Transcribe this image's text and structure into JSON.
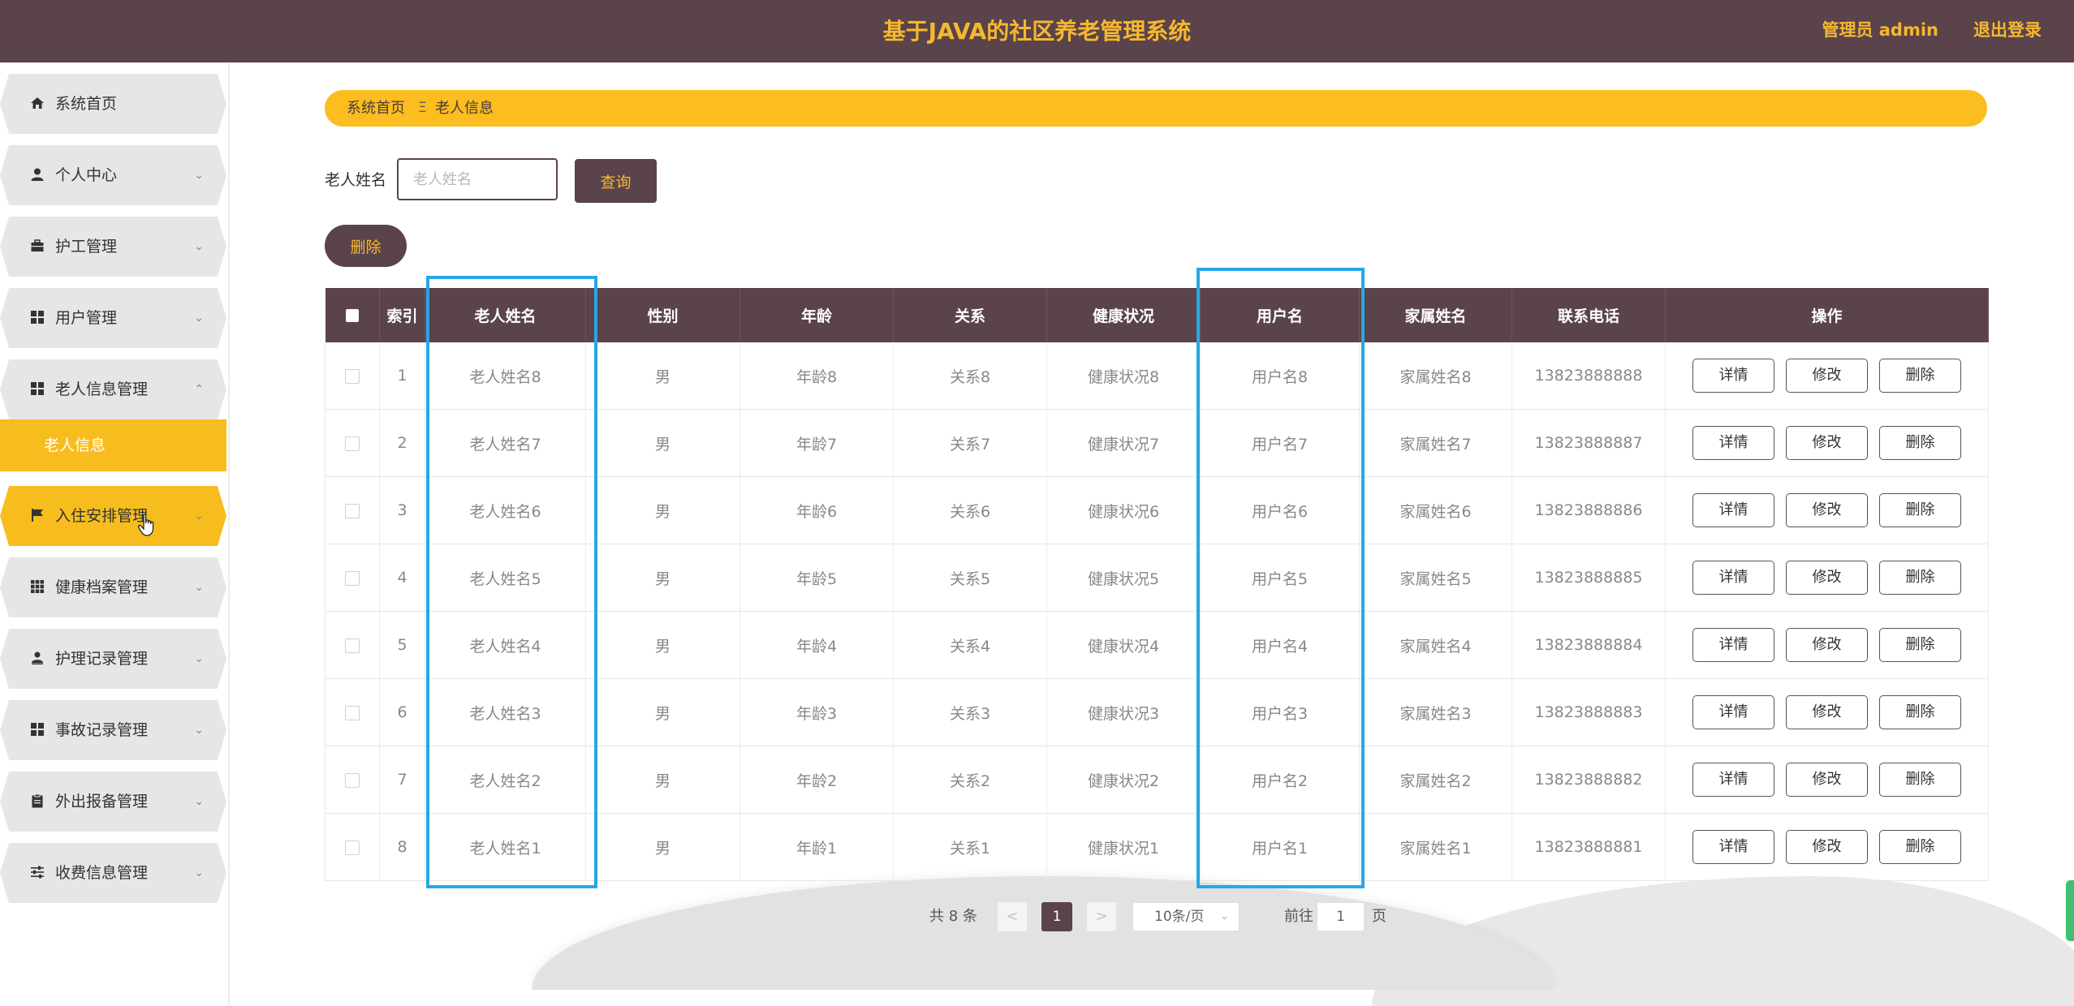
{
  "header": {
    "title": "基于JAVA的社区养老管理系统",
    "admin": "管理员 admin",
    "logout": "退出登录"
  },
  "sidebar": {
    "items": [
      {
        "label": "系统首页",
        "icon": "home-icon"
      },
      {
        "label": "个人中心",
        "icon": "user-icon"
      },
      {
        "label": "护工管理",
        "icon": "briefcase-icon"
      },
      {
        "label": "用户管理",
        "icon": "grid-icon"
      },
      {
        "label": "老人信息管理",
        "icon": "grid-icon"
      },
      {
        "label": "入住安排管理",
        "icon": "flag-icon"
      },
      {
        "label": "健康档案管理",
        "icon": "grid-9-icon"
      },
      {
        "label": "护理记录管理",
        "icon": "user-small-icon"
      },
      {
        "label": "事故记录管理",
        "icon": "grid-icon"
      },
      {
        "label": "外出报备管理",
        "icon": "clipboard-icon"
      },
      {
        "label": "收费信息管理",
        "icon": "sliders-icon"
      }
    ],
    "sub_item": "老人信息"
  },
  "breadcrumb": {
    "home": "系统首页",
    "separator": "Ξ",
    "current": "老人信息"
  },
  "search": {
    "label": "老人姓名",
    "placeholder": "老人姓名",
    "value": "",
    "query_button": "查询"
  },
  "batch_delete": "删除",
  "table": {
    "headers": [
      "索引",
      "老人姓名",
      "性别",
      "年龄",
      "关系",
      "健康状况",
      "用户名",
      "家属姓名",
      "联系电话",
      "操作"
    ],
    "rows": [
      {
        "index": "1",
        "name": "老人姓名8",
        "gender": "男",
        "age": "年龄8",
        "relation": "关系8",
        "health": "健康状况8",
        "username": "用户名8",
        "family": "家属姓名8",
        "phone": "13823888888"
      },
      {
        "index": "2",
        "name": "老人姓名7",
        "gender": "男",
        "age": "年龄7",
        "relation": "关系7",
        "health": "健康状况7",
        "username": "用户名7",
        "family": "家属姓名7",
        "phone": "13823888887"
      },
      {
        "index": "3",
        "name": "老人姓名6",
        "gender": "男",
        "age": "年龄6",
        "relation": "关系6",
        "health": "健康状况6",
        "username": "用户名6",
        "family": "家属姓名6",
        "phone": "13823888886"
      },
      {
        "index": "4",
        "name": "老人姓名5",
        "gender": "男",
        "age": "年龄5",
        "relation": "关系5",
        "health": "健康状况5",
        "username": "用户名5",
        "family": "家属姓名5",
        "phone": "13823888885"
      },
      {
        "index": "5",
        "name": "老人姓名4",
        "gender": "男",
        "age": "年龄4",
        "relation": "关系4",
        "health": "健康状况4",
        "username": "用户名4",
        "family": "家属姓名4",
        "phone": "13823888884"
      },
      {
        "index": "6",
        "name": "老人姓名3",
        "gender": "男",
        "age": "年龄3",
        "relation": "关系3",
        "health": "健康状况3",
        "username": "用户名3",
        "family": "家属姓名3",
        "phone": "13823888883"
      },
      {
        "index": "7",
        "name": "老人姓名2",
        "gender": "男",
        "age": "年龄2",
        "relation": "关系2",
        "health": "健康状况2",
        "username": "用户名2",
        "family": "家属姓名2",
        "phone": "13823888882"
      },
      {
        "index": "8",
        "name": "老人姓名1",
        "gender": "男",
        "age": "年龄1",
        "relation": "关系1",
        "health": "健康状况1",
        "username": "用户名1",
        "family": "家属姓名1",
        "phone": "13823888881"
      }
    ],
    "actions": {
      "detail": "详情",
      "edit": "修改",
      "delete": "删除"
    }
  },
  "pagination": {
    "total": "共 8 条",
    "prev": "<",
    "current": "1",
    "next": ">",
    "page_size": "10条/页",
    "goto_label": "前往",
    "goto_value": "1",
    "page_suffix": "页"
  },
  "colors": {
    "header_bg": "#5a434a",
    "accent_yellow": "#f7bc1e",
    "highlight_blue": "#27a7e9"
  }
}
